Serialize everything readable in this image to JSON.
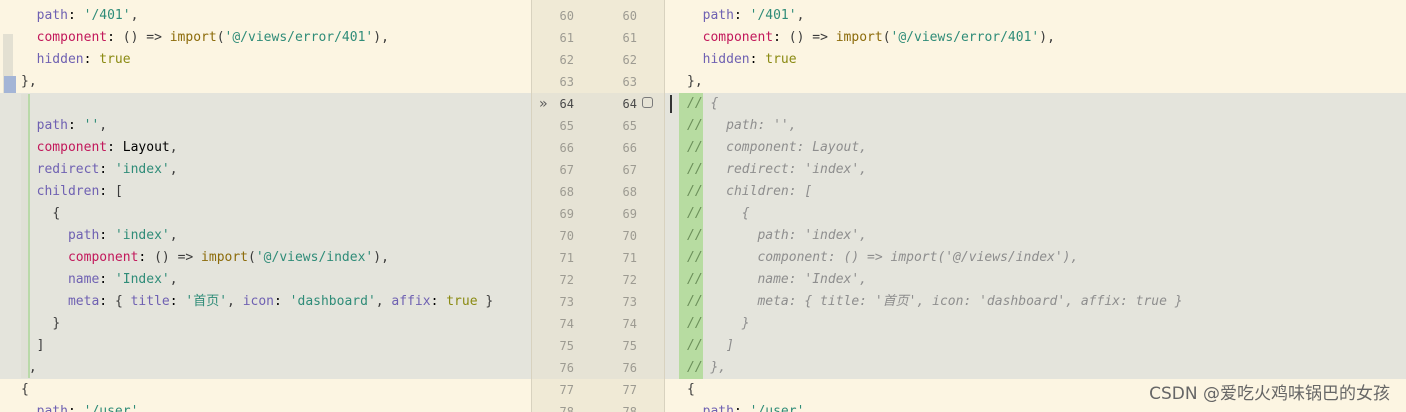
{
  "colors": {
    "background": "#fcf5e2",
    "changed_block": "#e4e4dc",
    "comment_marker": "#b7dca1",
    "key": "#6f61b2",
    "string": "#2f8c78",
    "function": "#8c6b0a",
    "component_key": "#c2185b",
    "boolean": "#8a8a12",
    "comment": "#8e8e8e"
  },
  "gutter": {
    "line_numbers": [
      {
        "left": "60",
        "right": "60"
      },
      {
        "left": "61",
        "right": "61"
      },
      {
        "left": "62",
        "right": "62"
      },
      {
        "left": "63",
        "right": "63"
      },
      {
        "left": "64",
        "right": "64",
        "active": true
      },
      {
        "left": "65",
        "right": "65"
      },
      {
        "left": "66",
        "right": "66"
      },
      {
        "left": "67",
        "right": "67"
      },
      {
        "left": "68",
        "right": "68"
      },
      {
        "left": "69",
        "right": "69"
      },
      {
        "left": "70",
        "right": "70"
      },
      {
        "left": "71",
        "right": "71"
      },
      {
        "left": "72",
        "right": "72"
      },
      {
        "left": "73",
        "right": "73"
      },
      {
        "left": "74",
        "right": "74"
      },
      {
        "left": "75",
        "right": "75"
      },
      {
        "left": "76",
        "right": "76"
      },
      {
        "left": "77",
        "right": "77"
      },
      {
        "left": "78",
        "right": "78"
      }
    ],
    "merge_arrow_icon": "double-chevron-right-icon",
    "checkbox_icon": "checkbox-icon"
  },
  "left_code": [
    "  path: '/401',",
    "  component: () => import('@/views/error/401'),",
    "  hidden: true",
    "},",
    "{",
    "  path: '',",
    "  component: Layout,",
    "  redirect: 'index',",
    "  children: [",
    "    {",
    "      path: 'index',",
    "      component: () => import('@/views/index'),",
    "      name: 'Index',",
    "      meta: { title: '首页', icon: 'dashboard', affix: true }",
    "    }",
    "  ]",
    "},",
    "{",
    "  path: '/user',"
  ],
  "right_code": [
    "  path: '/401',",
    "  component: () => import('@/views/error/401'),",
    "  hidden: true",
    "},",
    "// {",
    "//   path: '',",
    "//   component: Layout,",
    "//   redirect: 'index',",
    "//   children: [",
    "//     {",
    "//       path: 'index',",
    "//       component: () => import('@/views/index'),",
    "//       name: 'Index',",
    "//       meta: { title: '首页', icon: 'dashboard', affix: true }",
    "//     }",
    "//   ]",
    "// },",
    "{",
    "  path: '/user',"
  ],
  "watermark": "CSDN @爱吃火鸡味锅巴的女孩"
}
